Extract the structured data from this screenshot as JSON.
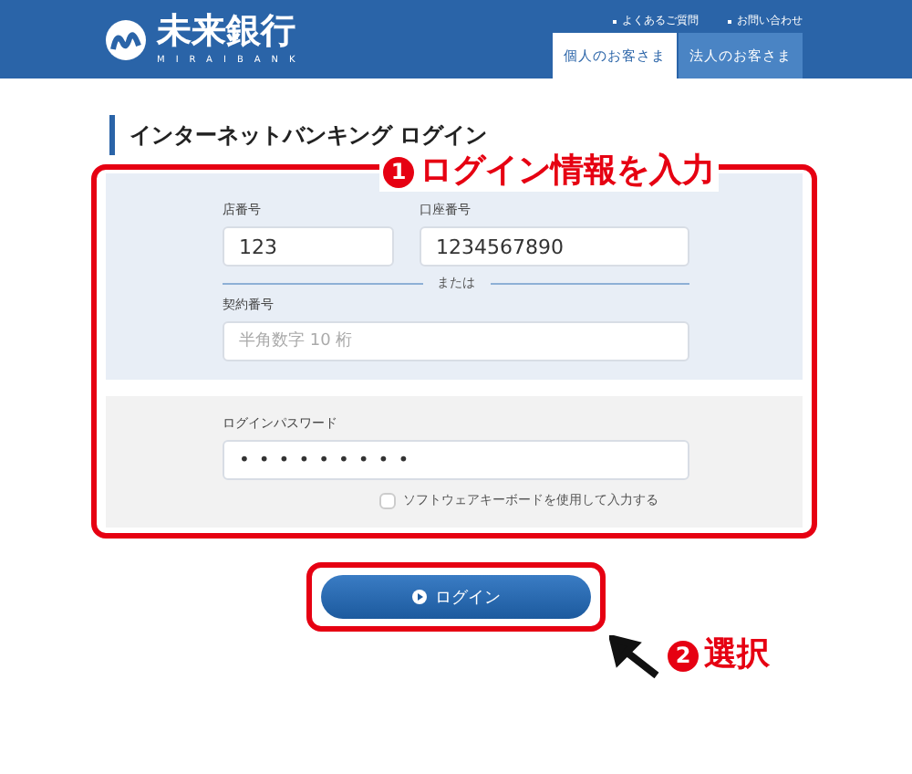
{
  "header": {
    "logo_text": "未来銀行",
    "logo_subtext": "MIRAIBANK",
    "links": [
      "よくあるご質問",
      "お問い合わせ"
    ],
    "tabs": [
      {
        "label": "個人のお客さま",
        "selected": true
      },
      {
        "label": "法人のお客さま",
        "selected": false
      }
    ]
  },
  "title": "インターネットバンキング ログイン",
  "form": {
    "branch": {
      "label": "店番号",
      "value": "123"
    },
    "account": {
      "label": "口座番号",
      "value": "1234567890"
    },
    "separator": "または",
    "contract": {
      "label": "契約番号",
      "placeholder": "半角数字 10 桁"
    },
    "password": {
      "label": "ログインパスワード",
      "value": "•••••••••"
    },
    "software_keyboard": {
      "label": "ソフトウェアキーボードを使用して入力する",
      "checked": false
    }
  },
  "login_button": "ログイン",
  "annotations": [
    {
      "number": "1",
      "text": "ログイン情報を入力"
    },
    {
      "number": "2",
      "text": "選択"
    }
  ]
}
